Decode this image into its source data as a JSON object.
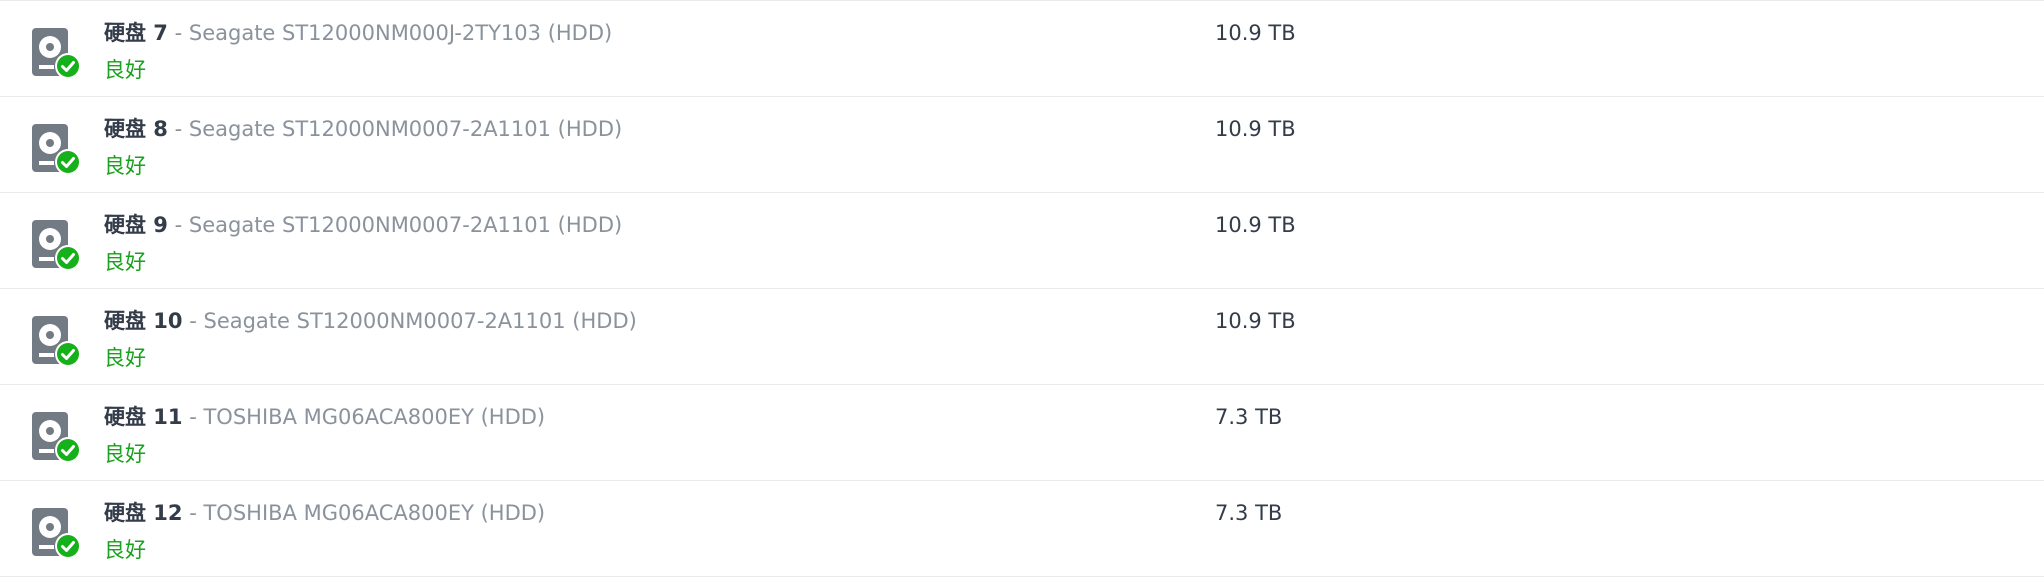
{
  "disks": [
    {
      "name": "硬盘 7",
      "model": "Seagate ST12000NM000J-2TY103 (HDD)",
      "status": "良好",
      "capacity": "10.9 TB"
    },
    {
      "name": "硬盘 8",
      "model": "Seagate ST12000NM0007-2A1101 (HDD)",
      "status": "良好",
      "capacity": "10.9 TB"
    },
    {
      "name": "硬盘 9",
      "model": "Seagate ST12000NM0007-2A1101 (HDD)",
      "status": "良好",
      "capacity": "10.9 TB"
    },
    {
      "name": "硬盘 10",
      "model": "Seagate ST12000NM0007-2A1101 (HDD)",
      "status": "良好",
      "capacity": "10.9 TB"
    },
    {
      "name": "硬盘 11",
      "model": "TOSHIBA MG06ACA800EY (HDD)",
      "status": "良好",
      "capacity": "7.3 TB"
    },
    {
      "name": "硬盘 12",
      "model": "TOSHIBA MG06ACA800EY (HDD)",
      "status": "良好",
      "capacity": "7.3 TB"
    }
  ],
  "separator": " - ",
  "icons": {
    "disk": "hard-disk-icon",
    "status": "check-circle-icon"
  },
  "colors": {
    "status_healthy": "#16a31a",
    "icon_gray": "#727a84",
    "model_text": "#8a929c"
  }
}
